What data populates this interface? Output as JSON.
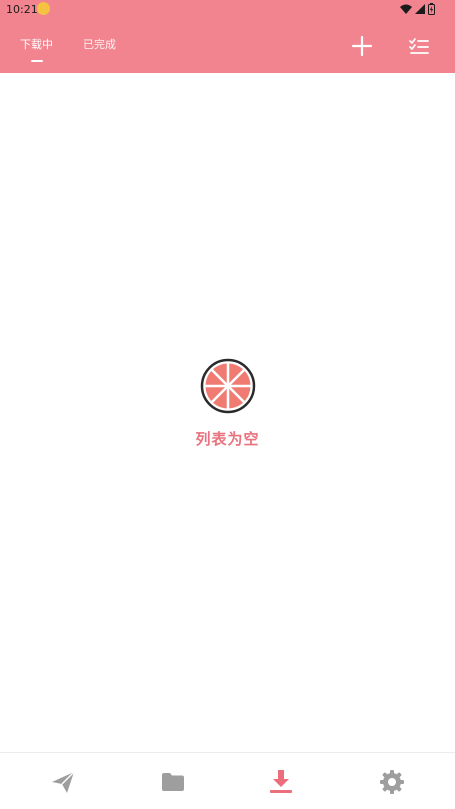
{
  "status_bar": {
    "time": "10:21"
  },
  "tabs": [
    {
      "label": "下载中",
      "active": true
    },
    {
      "label": "已完成",
      "active": false
    }
  ],
  "empty_state": {
    "text": "列表为空"
  },
  "colors": {
    "header": "#f2848f",
    "accent": "#e8737f",
    "nav_inactive": "#9e9e9e",
    "nav_active": "#ec6d7b"
  },
  "bottom_nav": [
    {
      "icon": "send-icon",
      "active": false
    },
    {
      "icon": "folder-icon",
      "active": false
    },
    {
      "icon": "download-icon",
      "active": true
    },
    {
      "icon": "gear-icon",
      "active": false
    }
  ]
}
